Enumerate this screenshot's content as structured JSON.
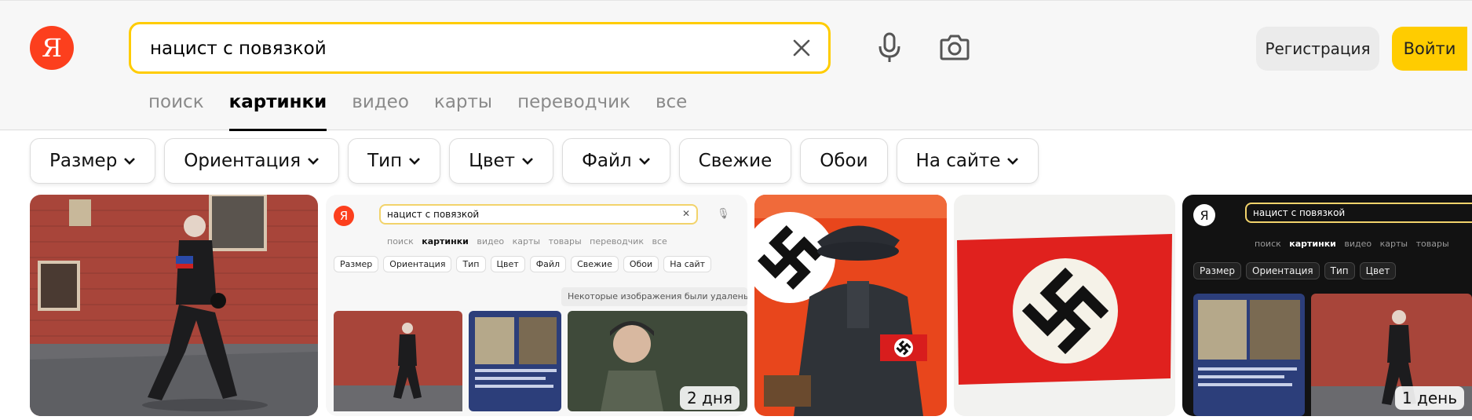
{
  "header": {
    "logo_letter": "Я",
    "search": {
      "value": "нацист с повязкой"
    },
    "register_label": "Регистрация",
    "login_label": "Войти",
    "tabs": [
      {
        "label": "поиск",
        "active": false
      },
      {
        "label": "картинки",
        "active": true
      },
      {
        "label": "видео",
        "active": false
      },
      {
        "label": "карты",
        "active": false
      },
      {
        "label": "переводчик",
        "active": false
      },
      {
        "label": "все",
        "active": false
      }
    ]
  },
  "filters": [
    {
      "label": "Размер",
      "dropdown": true
    },
    {
      "label": "Ориентация",
      "dropdown": true
    },
    {
      "label": "Тип",
      "dropdown": true
    },
    {
      "label": "Цвет",
      "dropdown": true
    },
    {
      "label": "Файл",
      "dropdown": true
    },
    {
      "label": "Свежие",
      "dropdown": false
    },
    {
      "label": "Обои",
      "dropdown": false
    },
    {
      "label": "На сайте",
      "dropdown": true
    }
  ],
  "results": {
    "tile2": {
      "search_text": "нацист с повязкой",
      "tabs": [
        "поиск",
        "картинки",
        "видео",
        "карты",
        "товары",
        "переводчик",
        "все"
      ],
      "chips": [
        "Размер",
        "Ориентация",
        "Тип",
        "Цвет",
        "Файл",
        "Свежие",
        "Обои",
        "На сайт"
      ],
      "notice": "Некоторые изображения были удалены из р",
      "badge": "2 дня"
    },
    "tile5": {
      "search_text": "нацист с повязкой",
      "tabs": [
        "поиск",
        "картинки",
        "видео",
        "карты",
        "товары"
      ],
      "chips": [
        "Размер",
        "Ориентация",
        "Тип",
        "Цвет"
      ],
      "badge": "1 день"
    }
  },
  "colors": {
    "brand_red": "#fc3f1d",
    "accent_yellow": "#ffcc00"
  },
  "icons": [
    "clear-icon",
    "microphone-icon",
    "camera-search-icon",
    "chevron-down-icon"
  ]
}
